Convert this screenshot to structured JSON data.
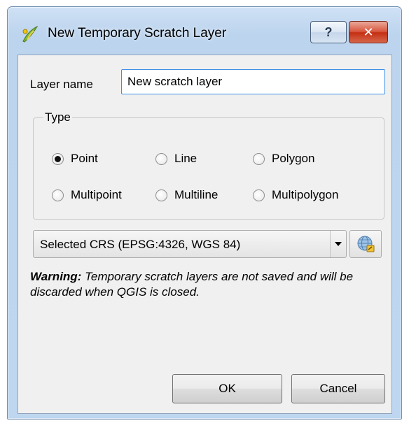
{
  "window": {
    "title": "New Temporary Scratch Layer",
    "help_label": "?",
    "close_label": "✕"
  },
  "layer_name": {
    "label": "Layer name",
    "value": "New scratch layer"
  },
  "type_group": {
    "legend": "Type",
    "options": [
      "Point",
      "Line",
      "Polygon",
      "Multipoint",
      "Multiline",
      "Multipolygon"
    ],
    "selected": "Point"
  },
  "crs": {
    "selected": "Selected CRS (EPSG:4326, WGS 84)",
    "selector_icon": "globe-crs-icon"
  },
  "warning": {
    "bold": "Warning:",
    "text": " Temporary scratch layers are not saved and will be discarded when QGIS is closed."
  },
  "buttons": {
    "ok": "OK",
    "cancel": "Cancel"
  },
  "colors": {
    "focus_border": "#3d8fe6",
    "close_red": "#c42f13"
  }
}
